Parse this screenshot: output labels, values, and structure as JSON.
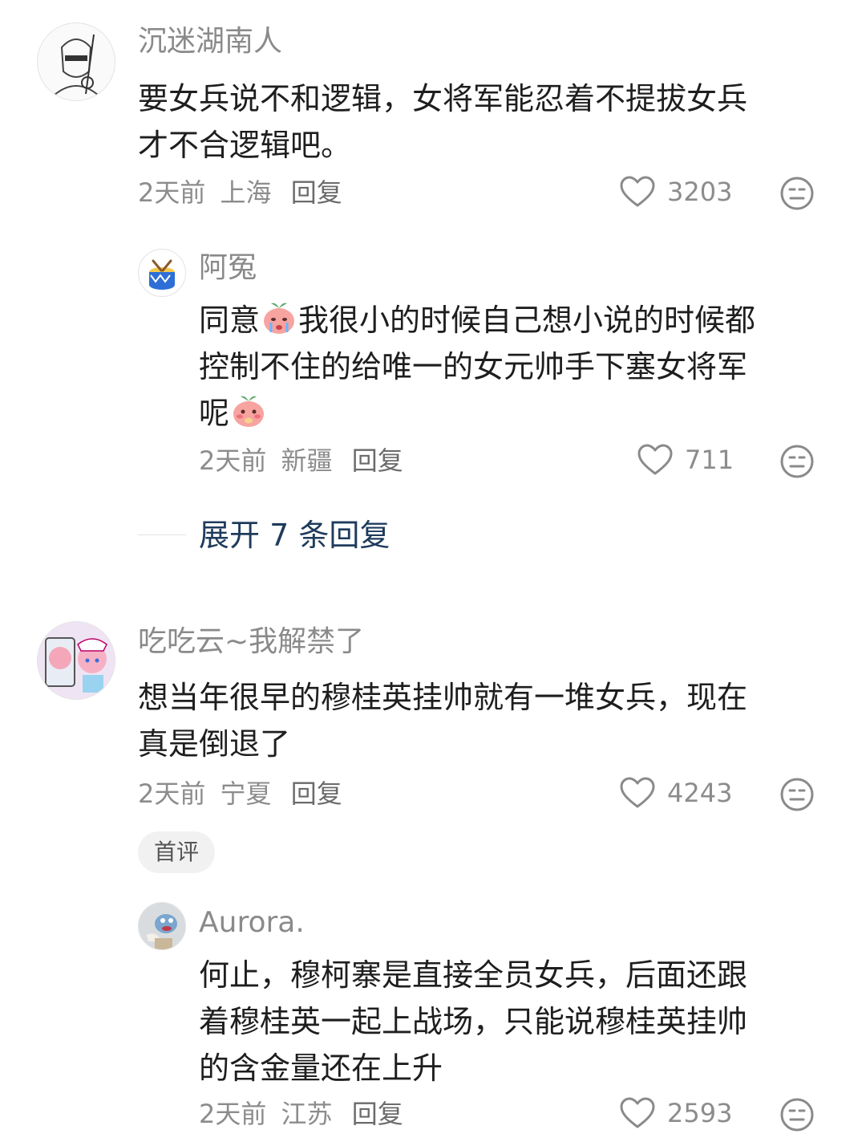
{
  "comments": [
    {
      "user": "沉迷湖南人",
      "text_lines": [
        "要女兵说不和逻辑，女将军能忍着不提拔女兵",
        "才不合逻辑吧。"
      ],
      "time": "2天前",
      "location": "上海",
      "reply_label": "回复",
      "likes": "3203",
      "reply": {
        "user": "阿冤",
        "line1_a": "同意",
        "line1_b": "我很小的时候自己想小说的时候都",
        "line2": "控制不住的给唯一的女元帅手下塞女将军",
        "line3": "呢",
        "time": "2天前",
        "location": "新疆",
        "reply_label": "回复",
        "likes": "711"
      },
      "expand_label": "展开 7 条回复"
    },
    {
      "user": "吃吃云~我解禁了",
      "text_lines": [
        "想当年很早的穆桂英挂帅就有一堆女兵，现在",
        "真是倒退了"
      ],
      "time": "2天前",
      "location": "宁夏",
      "reply_label": "回复",
      "likes": "4243",
      "badge": "首评",
      "reply": {
        "user": "Aurora.",
        "text_lines": [
          "何止，穆柯寨是直接全员女兵，后面还跟",
          "着穆桂英一起上战场，只能说穆桂英挂帅",
          "的含金量还在上升"
        ],
        "time": "2天前",
        "location": "江苏",
        "reply_label": "回复",
        "likes": "2593"
      }
    }
  ],
  "icons": {
    "like": "heart-outline-icon",
    "dislike": "meh-face-icon",
    "emoji_1": "crying-peach-emoji",
    "emoji_2": "shy-peach-emoji"
  }
}
